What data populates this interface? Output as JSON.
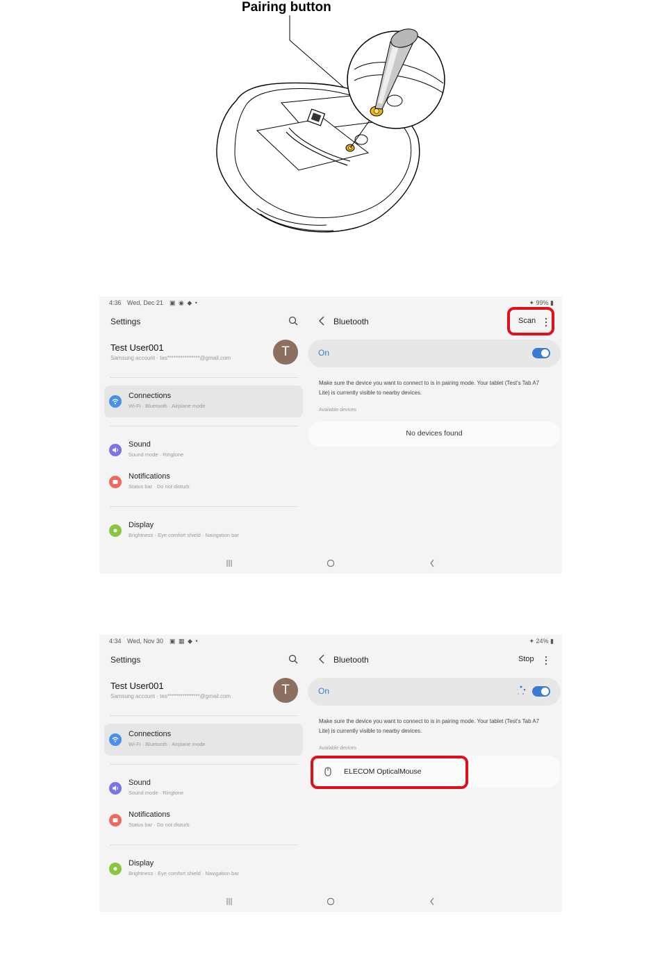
{
  "caption": "Pairing button",
  "screens": [
    {
      "status": {
        "time": "4:36",
        "date": "Wed, Dec 21",
        "icons": "▣ ◉ ◆ •",
        "battery": "✦ 99% ▮"
      },
      "settings_title": "Settings",
      "user": {
        "name": "Test User001",
        "sub": "Samsung account  ·  tes***************@gmail.com",
        "initial": "T"
      },
      "menu": [
        {
          "label": "Connections",
          "sub": "Wi-Fi  ·  Bluetooth  ·  Airplane mode"
        },
        {
          "label": "Sound",
          "sub": "Sound mode  ·  Ringtone"
        },
        {
          "label": "Notifications",
          "sub": "Status bar  ·  Do not disturb"
        },
        {
          "label": "Display",
          "sub": "Brightness  ·  Eye comfort shield  ·  Navigation bar"
        }
      ],
      "bluetooth": {
        "title": "Bluetooth",
        "action": "Scan",
        "on_label": "On",
        "hint": "Make sure the device you want to connect to is in pairing mode. Your tablet (Test's Tab A7 Lite) is currently visible to nearby devices.",
        "available": "Available devices",
        "no_devices": "No devices found"
      }
    },
    {
      "status": {
        "time": "4:34",
        "date": "Wed, Nov 30",
        "icons": "▣ ▦ ◆ •",
        "battery": "✦ 24% ▮"
      },
      "settings_title": "Settings",
      "user": {
        "name": "Test User001",
        "sub": "Samsung account  ·  tes***************@gmail.com",
        "initial": "T"
      },
      "menu": [
        {
          "label": "Connections",
          "sub": "Wi-Fi  ·  Bluetooth  ·  Airplane mode"
        },
        {
          "label": "Sound",
          "sub": "Sound mode  ·  Ringtone"
        },
        {
          "label": "Notifications",
          "sub": "Status bar  ·  Do not disturb"
        },
        {
          "label": "Display",
          "sub": "Brightness  ·  Eye comfort shield  ·  Navigation bar"
        }
      ],
      "bluetooth": {
        "title": "Bluetooth",
        "action": "Stop",
        "on_label": "On",
        "hint": "Make sure the device you want to connect to is in pairing mode. Your tablet (Test's Tab A7 Lite) is currently visible to nearby devices.",
        "available": "Available devices",
        "device_name": "ELECOM OpticalMouse"
      }
    }
  ],
  "colors": {
    "highlight": "#e0101a",
    "accent": "#3a7bd5",
    "avatar": "#8d6f62"
  }
}
